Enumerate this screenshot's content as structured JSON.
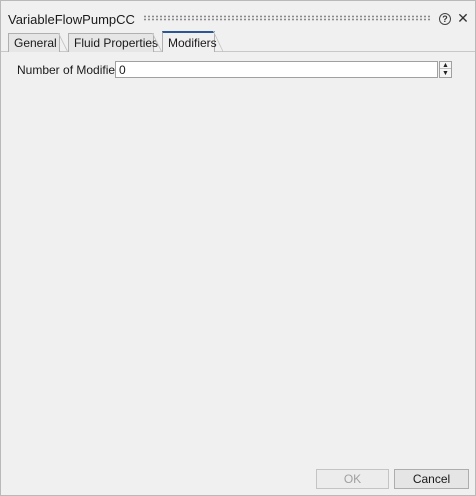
{
  "window": {
    "title": "VariableFlowPumpCC",
    "help_icon": "?",
    "close_icon": "✕"
  },
  "tabs": [
    {
      "label": "General",
      "active": false
    },
    {
      "label": "Fluid Properties",
      "active": false
    },
    {
      "label": "Modifiers",
      "active": true
    }
  ],
  "modifiers": {
    "number_label": "Number of Modifiers",
    "number_value": "0"
  },
  "spinner": {
    "up": "▲",
    "down": "▼"
  },
  "buttons": {
    "ok_label": "OK",
    "cancel_label": "Cancel",
    "ok_enabled": false
  },
  "colors": {
    "active_tab_accent": "#2b5797",
    "background": "#f0f0f0"
  }
}
